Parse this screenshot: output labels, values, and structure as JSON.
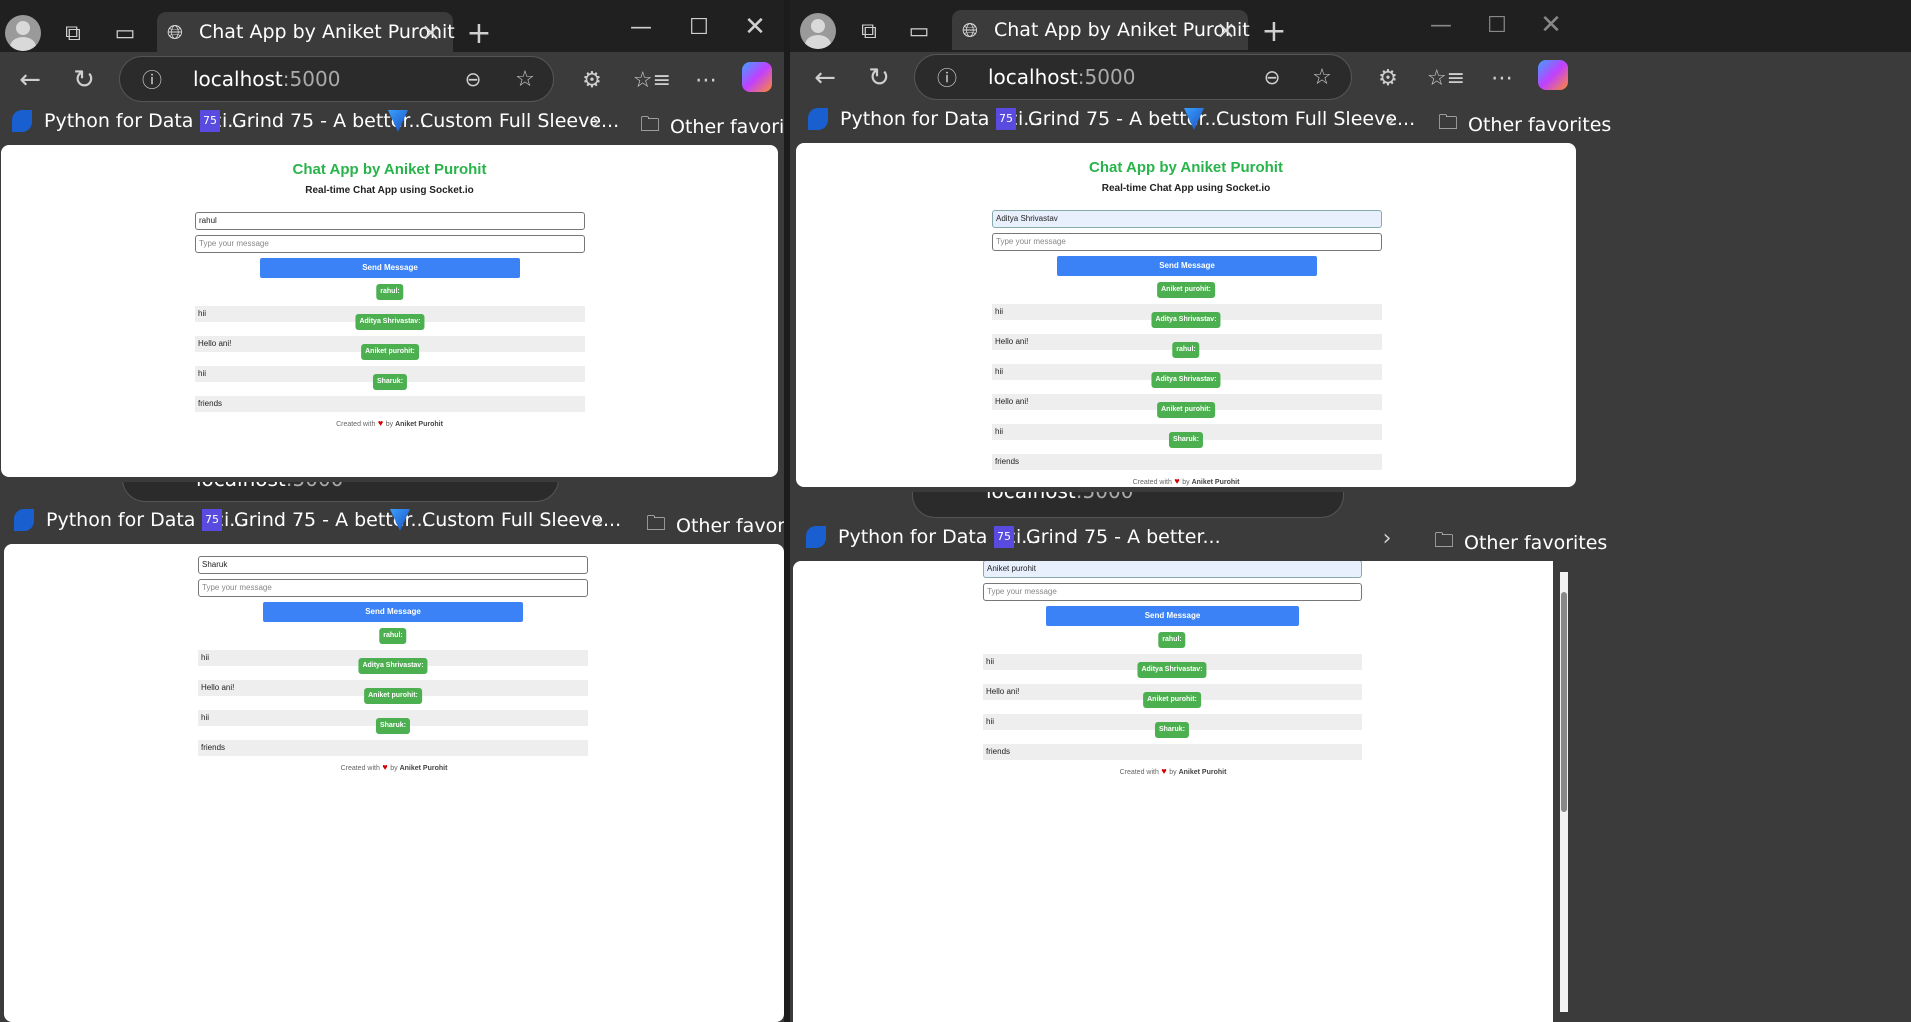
{
  "browser": {
    "tab_title": "Chat App by Aniket Purohit",
    "url_host": "localhost",
    "url_port": ":5000",
    "favorites": [
      "Python for Data Sci...",
      "Grind 75 - A better...",
      "Custom Full Sleeve..."
    ],
    "grind_icon_text": "75",
    "other_favorites": "Other favorites"
  },
  "app": {
    "title": "Chat App by Aniket Purohit",
    "subtitle": "Real-time Chat App using Socket.io",
    "message_placeholder": "Type your message",
    "send_label": "Send Message",
    "footer_prefix": "Created with",
    "footer_by": "by",
    "footer_author": "Aniket Purohit"
  },
  "windows": [
    {
      "username": "rahul",
      "messages": [
        {
          "sender": "rahul:",
          "text": "hii"
        },
        {
          "sender": "Aditya Shrivastav:",
          "text": "Hello ani!"
        },
        {
          "sender": "Aniket purohit:",
          "text": "hii"
        },
        {
          "sender": "Sharuk:",
          "text": "friends"
        }
      ]
    },
    {
      "username": "Aditya Shrivastav",
      "messages": [
        {
          "sender": "Aniket purohit:",
          "text": "hii"
        },
        {
          "sender": "Aditya Shrivastav:",
          "text": "Hello ani!"
        },
        {
          "sender": "rahul:",
          "text": "hii"
        },
        {
          "sender": "Aditya Shrivastav:",
          "text": "Hello ani!"
        },
        {
          "sender": "Aniket purohit:",
          "text": "hii"
        },
        {
          "sender": "Sharuk:",
          "text": "friends"
        }
      ]
    },
    {
      "username": "Sharuk",
      "messages": [
        {
          "sender": "rahul:",
          "text": "hii"
        },
        {
          "sender": "Aditya Shrivastav:",
          "text": "Hello ani!"
        },
        {
          "sender": "Aniket purohit:",
          "text": "hii"
        },
        {
          "sender": "Sharuk:",
          "text": "friends"
        }
      ]
    },
    {
      "username": "Aniket purohit",
      "messages": [
        {
          "sender": "rahul:",
          "text": "hii"
        },
        {
          "sender": "Aditya Shrivastav:",
          "text": "Hello ani!"
        },
        {
          "sender": "Aniket purohit:",
          "text": "hii"
        },
        {
          "sender": "Sharuk:",
          "text": "friends"
        }
      ]
    }
  ]
}
